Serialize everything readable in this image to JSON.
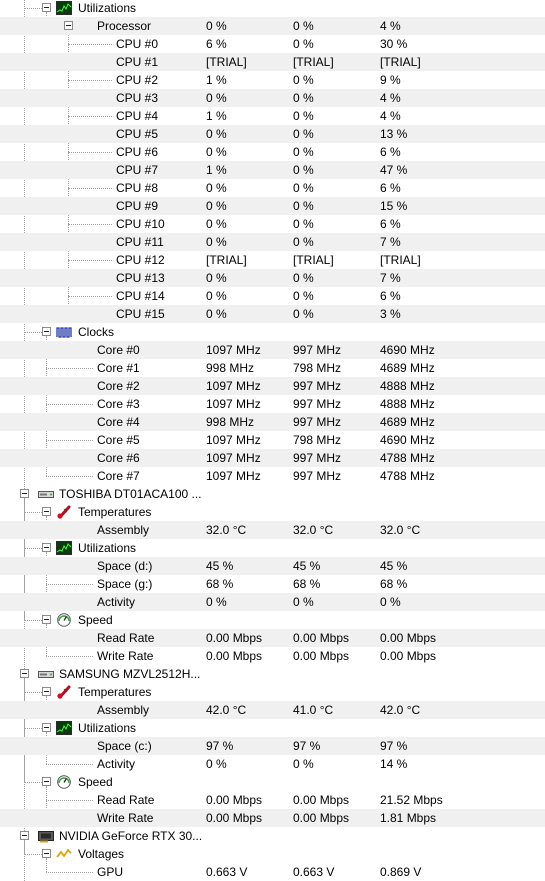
{
  "rows": [
    {
      "level": 1,
      "toggle": true,
      "icon": "utilization-icon",
      "label": "Utilizations"
    },
    {
      "level": 2,
      "toggle": true,
      "icon": null,
      "label": "Processor",
      "v1": "0 %",
      "v2": "0 %",
      "v3": "4 %"
    },
    {
      "level": 3,
      "label": "CPU #0",
      "v1": "6 %",
      "v2": "0 %",
      "v3": "30 %"
    },
    {
      "level": 3,
      "label": "CPU #1",
      "v1": "[TRIAL]",
      "v2": "[TRIAL]",
      "v3": "[TRIAL]"
    },
    {
      "level": 3,
      "label": "CPU #2",
      "v1": "1 %",
      "v2": "0 %",
      "v3": "9 %"
    },
    {
      "level": 3,
      "label": "CPU #3",
      "v1": "0 %",
      "v2": "0 %",
      "v3": "4 %"
    },
    {
      "level": 3,
      "label": "CPU #4",
      "v1": "1 %",
      "v2": "0 %",
      "v3": "4 %"
    },
    {
      "level": 3,
      "label": "CPU #5",
      "v1": "0 %",
      "v2": "0 %",
      "v3": "13 %"
    },
    {
      "level": 3,
      "label": "CPU #6",
      "v1": "0 %",
      "v2": "0 %",
      "v3": "6 %"
    },
    {
      "level": 3,
      "label": "CPU #7",
      "v1": "1 %",
      "v2": "0 %",
      "v3": "47 %"
    },
    {
      "level": 3,
      "label": "CPU #8",
      "v1": "0 %",
      "v2": "0 %",
      "v3": "6 %"
    },
    {
      "level": 3,
      "label": "CPU #9",
      "v1": "0 %",
      "v2": "0 %",
      "v3": "15 %"
    },
    {
      "level": 3,
      "label": "CPU #10",
      "v1": "0 %",
      "v2": "0 %",
      "v3": "6 %"
    },
    {
      "level": 3,
      "label": "CPU #11",
      "v1": "0 %",
      "v2": "0 %",
      "v3": "7 %"
    },
    {
      "level": 3,
      "label": "CPU #12",
      "v1": "[TRIAL]",
      "v2": "[TRIAL]",
      "v3": "[TRIAL]"
    },
    {
      "level": 3,
      "label": "CPU #13",
      "v1": "0 %",
      "v2": "0 %",
      "v3": "7 %"
    },
    {
      "level": 3,
      "label": "CPU #14",
      "v1": "0 %",
      "v2": "0 %",
      "v3": "6 %"
    },
    {
      "level": 3,
      "label": "CPU #15",
      "v1": "0 %",
      "v2": "0 %",
      "v3": "3 %"
    },
    {
      "level": 1,
      "toggle": true,
      "icon": "clock-icon",
      "label": "Clocks"
    },
    {
      "level": 2,
      "label": "Core #0",
      "v1": "1097 MHz",
      "v2": "997 MHz",
      "v3": "4690 MHz"
    },
    {
      "level": 2,
      "label": "Core #1",
      "v1": "998 MHz",
      "v2": "798 MHz",
      "v3": "4689 MHz"
    },
    {
      "level": 2,
      "label": "Core #2",
      "v1": "1097 MHz",
      "v2": "997 MHz",
      "v3": "4888 MHz"
    },
    {
      "level": 2,
      "label": "Core #3",
      "v1": "1097 MHz",
      "v2": "997 MHz",
      "v3": "4888 MHz"
    },
    {
      "level": 2,
      "label": "Core #4",
      "v1": "998 MHz",
      "v2": "997 MHz",
      "v3": "4689 MHz"
    },
    {
      "level": 2,
      "label": "Core #5",
      "v1": "1097 MHz",
      "v2": "798 MHz",
      "v3": "4690 MHz"
    },
    {
      "level": 2,
      "label": "Core #6",
      "v1": "1097 MHz",
      "v2": "997 MHz",
      "v3": "4788 MHz"
    },
    {
      "level": 2,
      "label": "Core #7",
      "v1": "1097 MHz",
      "v2": "997 MHz",
      "v3": "4788 MHz"
    },
    {
      "level": 0,
      "toggle": true,
      "icon": "hdd-icon",
      "label": "TOSHIBA DT01ACA100 ..."
    },
    {
      "level": 1,
      "toggle": true,
      "icon": "temperature-icon",
      "label": "Temperatures"
    },
    {
      "level": 2,
      "label": "Assembly",
      "v1": "32.0 °C",
      "v2": "32.0 °C",
      "v3": "32.0 °C"
    },
    {
      "level": 1,
      "toggle": true,
      "icon": "utilization-icon",
      "label": "Utilizations"
    },
    {
      "level": 2,
      "label": "Space (d:)",
      "v1": "45 %",
      "v2": "45 %",
      "v3": "45 %"
    },
    {
      "level": 2,
      "label": "Space (g:)",
      "v1": "68 %",
      "v2": "68 %",
      "v3": "68 %"
    },
    {
      "level": 2,
      "label": "Activity",
      "v1": "0 %",
      "v2": "0 %",
      "v3": "0 %"
    },
    {
      "level": 1,
      "toggle": true,
      "icon": "speed-icon",
      "label": "Speed"
    },
    {
      "level": 2,
      "label": "Read Rate",
      "v1": "0.00 Mbps",
      "v2": "0.00 Mbps",
      "v3": "0.00 Mbps"
    },
    {
      "level": 2,
      "label": "Write Rate",
      "v1": "0.00 Mbps",
      "v2": "0.00 Mbps",
      "v3": "0.00 Mbps"
    },
    {
      "level": 0,
      "toggle": true,
      "icon": "hdd-icon",
      "label": "SAMSUNG MZVL2512H..."
    },
    {
      "level": 1,
      "toggle": true,
      "icon": "temperature-icon",
      "label": "Temperatures"
    },
    {
      "level": 2,
      "label": "Assembly",
      "v1": "42.0 °C",
      "v2": "41.0 °C",
      "v3": "42.0 °C"
    },
    {
      "level": 1,
      "toggle": true,
      "icon": "utilization-icon",
      "label": "Utilizations"
    },
    {
      "level": 2,
      "label": "Space (c:)",
      "v1": "97 %",
      "v2": "97 %",
      "v3": "97 %"
    },
    {
      "level": 2,
      "label": "Activity",
      "v1": "0 %",
      "v2": "0 %",
      "v3": "14 %"
    },
    {
      "level": 1,
      "toggle": true,
      "icon": "speed-icon",
      "label": "Speed"
    },
    {
      "level": 2,
      "label": "Read Rate",
      "v1": "0.00 Mbps",
      "v2": "0.00 Mbps",
      "v3": "21.52 Mbps"
    },
    {
      "level": 2,
      "label": "Write Rate",
      "v1": "0.00 Mbps",
      "v2": "0.00 Mbps",
      "v3": "1.81 Mbps"
    },
    {
      "level": 0,
      "toggle": true,
      "icon": "gpu-icon",
      "label": "NVIDIA GeForce RTX 30..."
    },
    {
      "level": 1,
      "toggle": true,
      "icon": "voltage-icon",
      "label": "Voltages"
    },
    {
      "level": 2,
      "label": "GPU",
      "v1": "0.663 V",
      "v2": "0.663 V",
      "v3": "0.869 V"
    }
  ]
}
